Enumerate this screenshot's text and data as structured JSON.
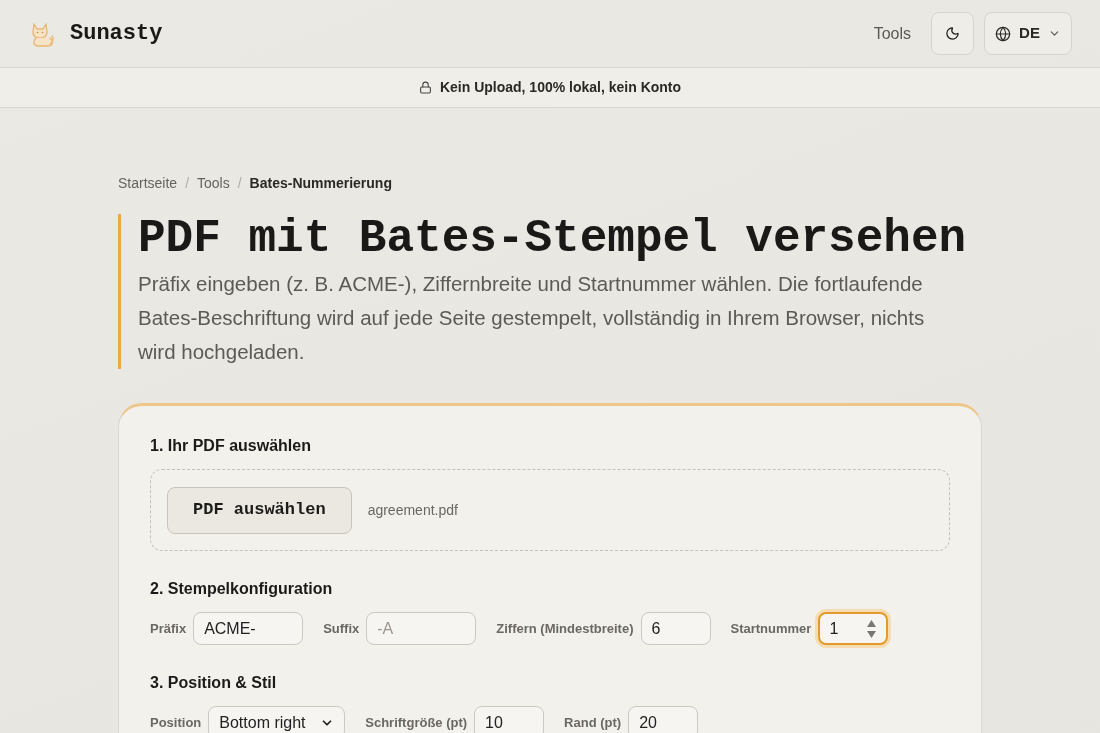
{
  "header": {
    "brand": "Sunasty",
    "nav_link": "Tools",
    "language_button": {
      "label": "DE"
    }
  },
  "banner": {
    "text": "Kein Upload, 100% lokal, kein Konto"
  },
  "breadcrumb": [
    {
      "kind": "link",
      "label": "Startseite"
    },
    {
      "kind": "separator",
      "label": "/"
    },
    {
      "kind": "link",
      "label": "Tools"
    },
    {
      "kind": "separator",
      "label": "/"
    },
    {
      "kind": "current",
      "label": "Bates-Nummerierung"
    }
  ],
  "page": {
    "title": "PDF mit Bates-Stempel versehen",
    "description": "Präfix eingeben (z. B. ACME-), Ziffernbreite und Startnummer wählen. Die fortlaufende Bates-Beschriftung wird auf jede Seite gestempelt, vollständig in Ihrem Browser, nichts wird hochgeladen."
  },
  "sections": [
    {
      "kind": "file",
      "heading": "1. Ihr PDF auswählen",
      "button": "PDF auswählen",
      "file_name": "agreement.pdf"
    },
    {
      "kind": "fields",
      "heading": "2. Stempelkonfiguration",
      "fields": [
        {
          "kind": "text",
          "label": "Präfix",
          "value": "ACME-",
          "focused": false
        },
        {
          "kind": "text",
          "label": "Suffix",
          "placeholder": "-A",
          "focused": false
        },
        {
          "kind": "number",
          "label": "Ziffern (Mindestbreite)",
          "value": "6",
          "focused": false
        },
        {
          "kind": "number",
          "label": "Startnummer",
          "value": "1",
          "focused": true
        }
      ]
    },
    {
      "kind": "fields",
      "heading": "3. Position & Stil",
      "fields": [
        {
          "kind": "select",
          "label": "Position",
          "value": "Bottom right",
          "focused": false
        },
        {
          "kind": "number",
          "label": "Schriftgröße (pt)",
          "value": "10",
          "focused": false
        },
        {
          "kind": "number",
          "label": "Rand (pt)",
          "value": "20",
          "focused": false
        }
      ]
    }
  ]
}
